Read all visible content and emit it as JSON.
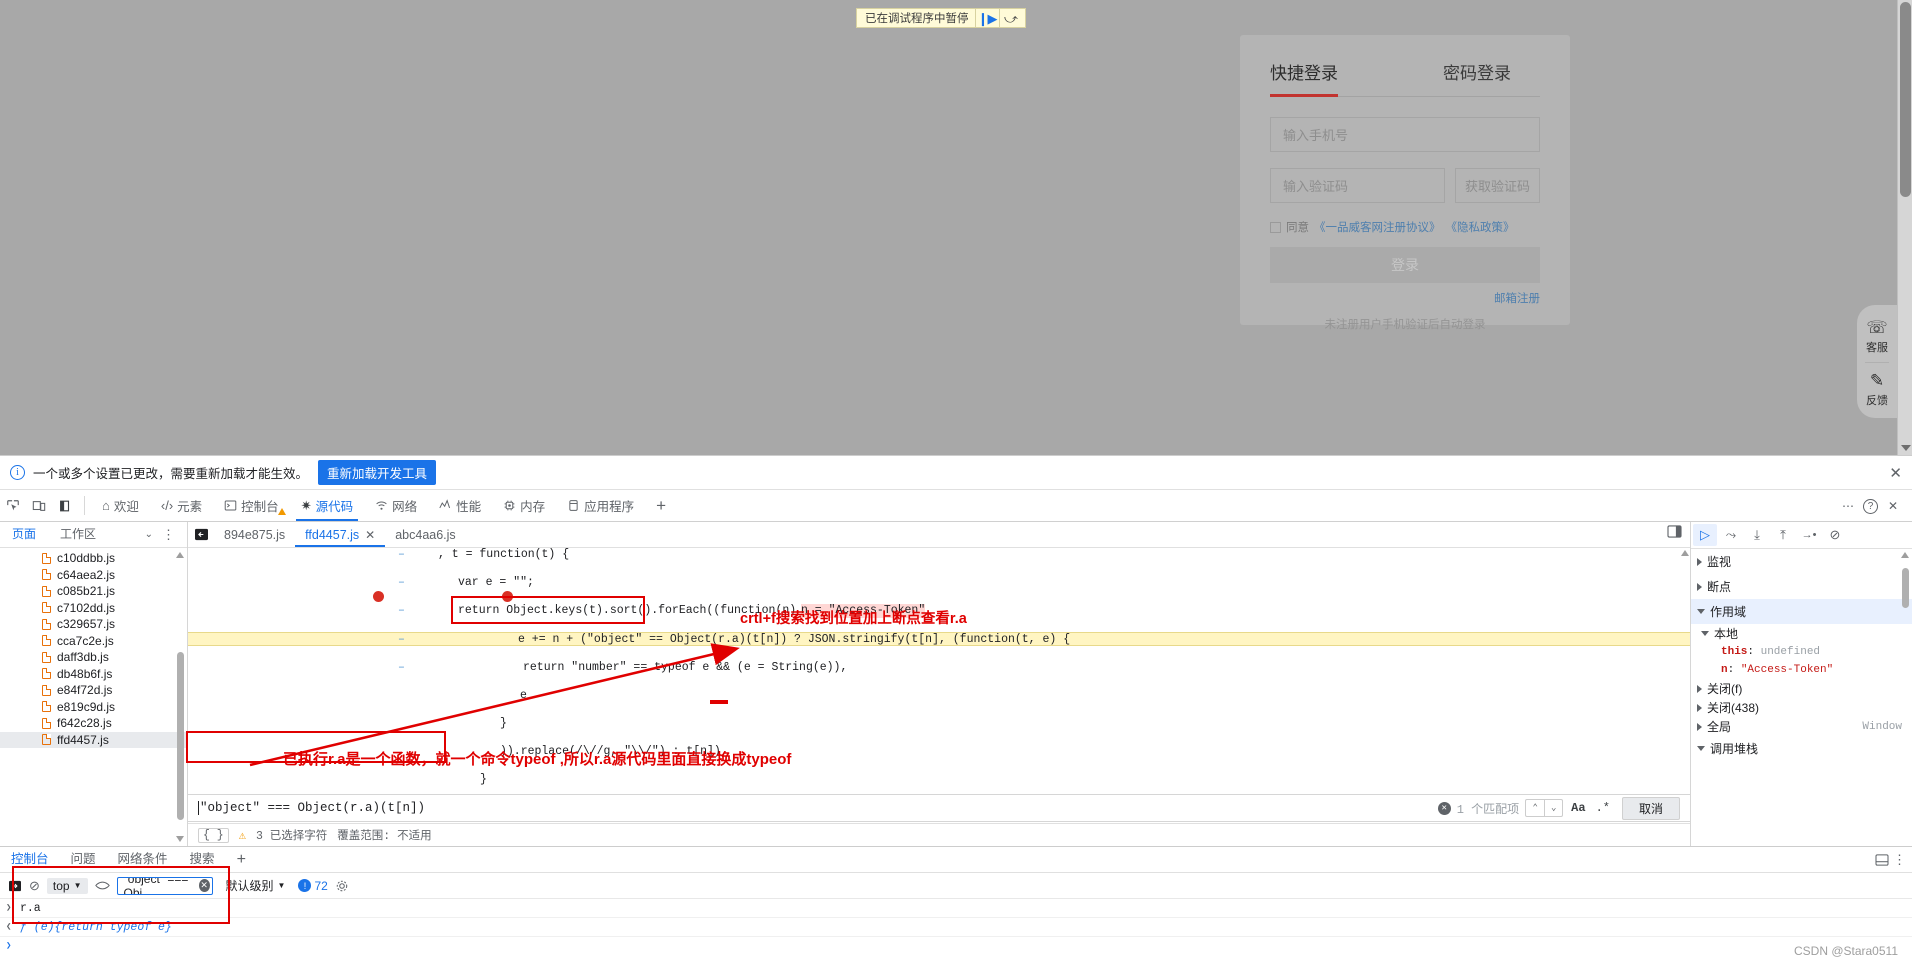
{
  "page": {
    "pause_banner": {
      "label": "已在调试程序中暂停",
      "resume_icon": "resume-icon",
      "step_icon": "step-over-icon"
    },
    "login": {
      "tabs": [
        {
          "label": "快捷登录",
          "active": true
        },
        {
          "label": "密码登录",
          "active": false
        }
      ],
      "phone_placeholder": "输入手机号",
      "code_placeholder": "输入验证码",
      "get_code_label": "获取验证码",
      "agree_prefix": "同意",
      "agree_link1": "《一品威客网注册协议》",
      "agree_link2": "《隐私政策》",
      "login_button": "登录",
      "email_register": "邮箱注册",
      "note": "未注册用户手机验证后自动登录"
    },
    "side_panel": [
      {
        "icon": "headset-icon",
        "glyph": "☎",
        "label": "客服"
      },
      {
        "icon": "edit-pencil-icon",
        "glyph": "✎",
        "label": "反馈"
      }
    ]
  },
  "devtools": {
    "infobar": {
      "message": "一个或多个设置已更改，需要重新加载才能生效。",
      "button": "重新加载开发工具",
      "close_icon": "close-icon"
    },
    "toolbar_icons": [
      {
        "name": "inspect-element-icon",
        "glyph": "⌗"
      },
      {
        "name": "device-toolbar-icon",
        "glyph": "▯"
      },
      {
        "name": "dock-side-icon",
        "glyph": "▮"
      }
    ],
    "tabs": [
      {
        "label": "欢迎",
        "icon": "home-icon",
        "glyph": "⌂",
        "active": false
      },
      {
        "label": "元素",
        "icon": "code-brackets-icon",
        "glyph": "‹›",
        "active": false
      },
      {
        "label": "控制台",
        "icon": "console-terminal-icon",
        "glyph": "▣",
        "active": false,
        "warning": true
      },
      {
        "label": "源代码",
        "icon": "bug-sources-icon",
        "glyph": "✻",
        "active": true
      },
      {
        "label": "网络",
        "icon": "network-wifi-icon",
        "glyph": "◔",
        "active": false
      },
      {
        "label": "性能",
        "icon": "performance-icon",
        "glyph": "⌇",
        "active": false
      },
      {
        "label": "内存",
        "icon": "memory-chip-icon",
        "glyph": "⚙",
        "active": false
      },
      {
        "label": "应用程序",
        "icon": "application-icon",
        "glyph": "▯",
        "active": false
      }
    ],
    "add_tab": "+",
    "more_icon": "⋯",
    "help_icon": "?",
    "close_icon": "✕",
    "nav": {
      "tabs": [
        {
          "label": "页面",
          "active": true
        },
        {
          "label": "工作区",
          "active": false
        }
      ],
      "caret_icon": "chevron-down-icon",
      "more_icon": "more-options-icon",
      "files": [
        {
          "name": "c10ddbb.js",
          "selected": false
        },
        {
          "name": "c64aea2.js",
          "selected": false
        },
        {
          "name": "c085b21.js",
          "selected": false
        },
        {
          "name": "c7102dd.js",
          "selected": false
        },
        {
          "name": "c329657.js",
          "selected": false
        },
        {
          "name": "cca7c2e.js",
          "selected": false
        },
        {
          "name": "daff3db.js",
          "selected": false
        },
        {
          "name": "db48b6f.js",
          "selected": false
        },
        {
          "name": "e84f72d.js",
          "selected": false
        },
        {
          "name": "e819c9d.js",
          "selected": false
        },
        {
          "name": "f642c28.js",
          "selected": false
        },
        {
          "name": "ffd4457.js",
          "selected": true
        }
      ]
    },
    "editor": {
      "tabs": [
        {
          "label": "894e875.js",
          "active": false,
          "closable": false
        },
        {
          "label": "ffd4457.js",
          "active": true,
          "closable": true
        },
        {
          "label": "abc4aa6.js",
          "active": false,
          "closable": false
        }
      ],
      "show_nav_icon": "show-navigator-icon",
      "popout_icon": "popout-editor-icon",
      "code_lines": [
        ", t = function(t) {",
        "var e = \"\";",
        "return Object.keys(t).sort().forEach((function(n) {",
        "e += n + (\"object\" == Object(r.a)(t[n]) ? JSON.stringify(t[n], (function(t, e) {",
        "return \"number\" == typeof e && (e = String(e)),",
        "e",
        "}",
        ")).replace(/\\//g, \"\\\\/\") : t[n])",
        "}",
        ")),"
      ],
      "highlighted_var": "n = \"Access-Token\"",
      "breakpoint_icon": "breakpoint-dot",
      "status": {
        "format_icon": "{ }",
        "selection": "3 已选择字符",
        "coverage": "覆盖范围: 不适用"
      }
    },
    "search": {
      "query": "\"object\" === Object(r.a)(t[n])",
      "clear_icon": "clear-search-icon",
      "match_count": "1 个匹配项",
      "prev_icon": "chevron-up-icon",
      "next_icon": "chevron-down-icon",
      "match_case_label": "Aa",
      "regex_label": ".*",
      "cancel_label": "取消"
    },
    "debugger": {
      "controls": [
        {
          "name": "resume-script-button",
          "glyph": "▷",
          "active": true
        },
        {
          "name": "step-over-button",
          "glyph": "⤴"
        },
        {
          "name": "step-into-button",
          "glyph": "⤓"
        },
        {
          "name": "step-out-button",
          "glyph": "⤑"
        },
        {
          "name": "step-button",
          "glyph": "→•"
        },
        {
          "name": "deactivate-breakpoints-button",
          "glyph": "⊘"
        }
      ],
      "sections": [
        {
          "label": "监视",
          "expanded": false
        },
        {
          "label": "断点",
          "expanded": false
        },
        {
          "label": "作用域",
          "expanded": true
        }
      ],
      "scope": {
        "local_label": "本地",
        "entries": [
          {
            "key": "this",
            "value": "undefined",
            "is_string": false
          },
          {
            "key": "n",
            "value": "\"Access-Token\"",
            "is_string": true
          }
        ],
        "closures": [
          {
            "label": "关闭(f)"
          },
          {
            "label": "关闭(438)"
          }
        ],
        "global": {
          "label": "全局",
          "value": "Window"
        }
      },
      "call_stack_label": "调用堆栈"
    },
    "drawer": {
      "tabs": [
        {
          "label": "控制台",
          "active": true
        },
        {
          "label": "问题",
          "active": false
        },
        {
          "label": "网络条件",
          "active": false
        },
        {
          "label": "搜索",
          "active": false
        }
      ],
      "add_tab": "+",
      "right_icons": [
        {
          "name": "dock-drawer-icon",
          "glyph": "◳"
        },
        {
          "name": "more-drawer-options-icon",
          "glyph": "⋮"
        }
      ],
      "console_toolbar": {
        "clear_icon": "clear-console-icon",
        "no_entry_icon": "no-entry-icon",
        "context": "top",
        "eye_icon": "live-expression-icon",
        "filter_value": "\"object\" === Obj",
        "filter_clear_icon": "clear-filter-icon",
        "level": "默认级别",
        "issue_count": "72",
        "settings_icon": "gear-icon"
      },
      "console_entries": [
        {
          "type": "input",
          "text": "r.a",
          "chevron": "❯"
        },
        {
          "type": "output",
          "text": "ƒ (e){return typeof e}",
          "chevron": "❮"
        }
      ]
    }
  },
  "annotations": {
    "search_hint": "crtl+f搜索找到位置加上断点查看r.a",
    "console_hint": "已执行r.a是一个函数，就一个命令typeof ,所以r.a源代码里面直接换成typeof"
  },
  "watermark": "CSDN @Stara0511"
}
